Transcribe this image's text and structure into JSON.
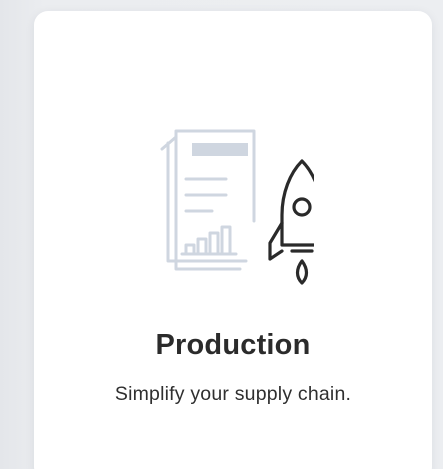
{
  "card": {
    "title": "Production",
    "subtitle": "Simplify your supply chain.",
    "illustration": {
      "document_icon": "document-chart-icon",
      "rocket_icon": "rocket-icon"
    }
  },
  "colors": {
    "background": "#e7e9ed",
    "card": "#ffffff",
    "title": "#2b2b2b",
    "document_stroke": "#cfd6e0",
    "rocket_stroke": "#2a2a2a"
  }
}
